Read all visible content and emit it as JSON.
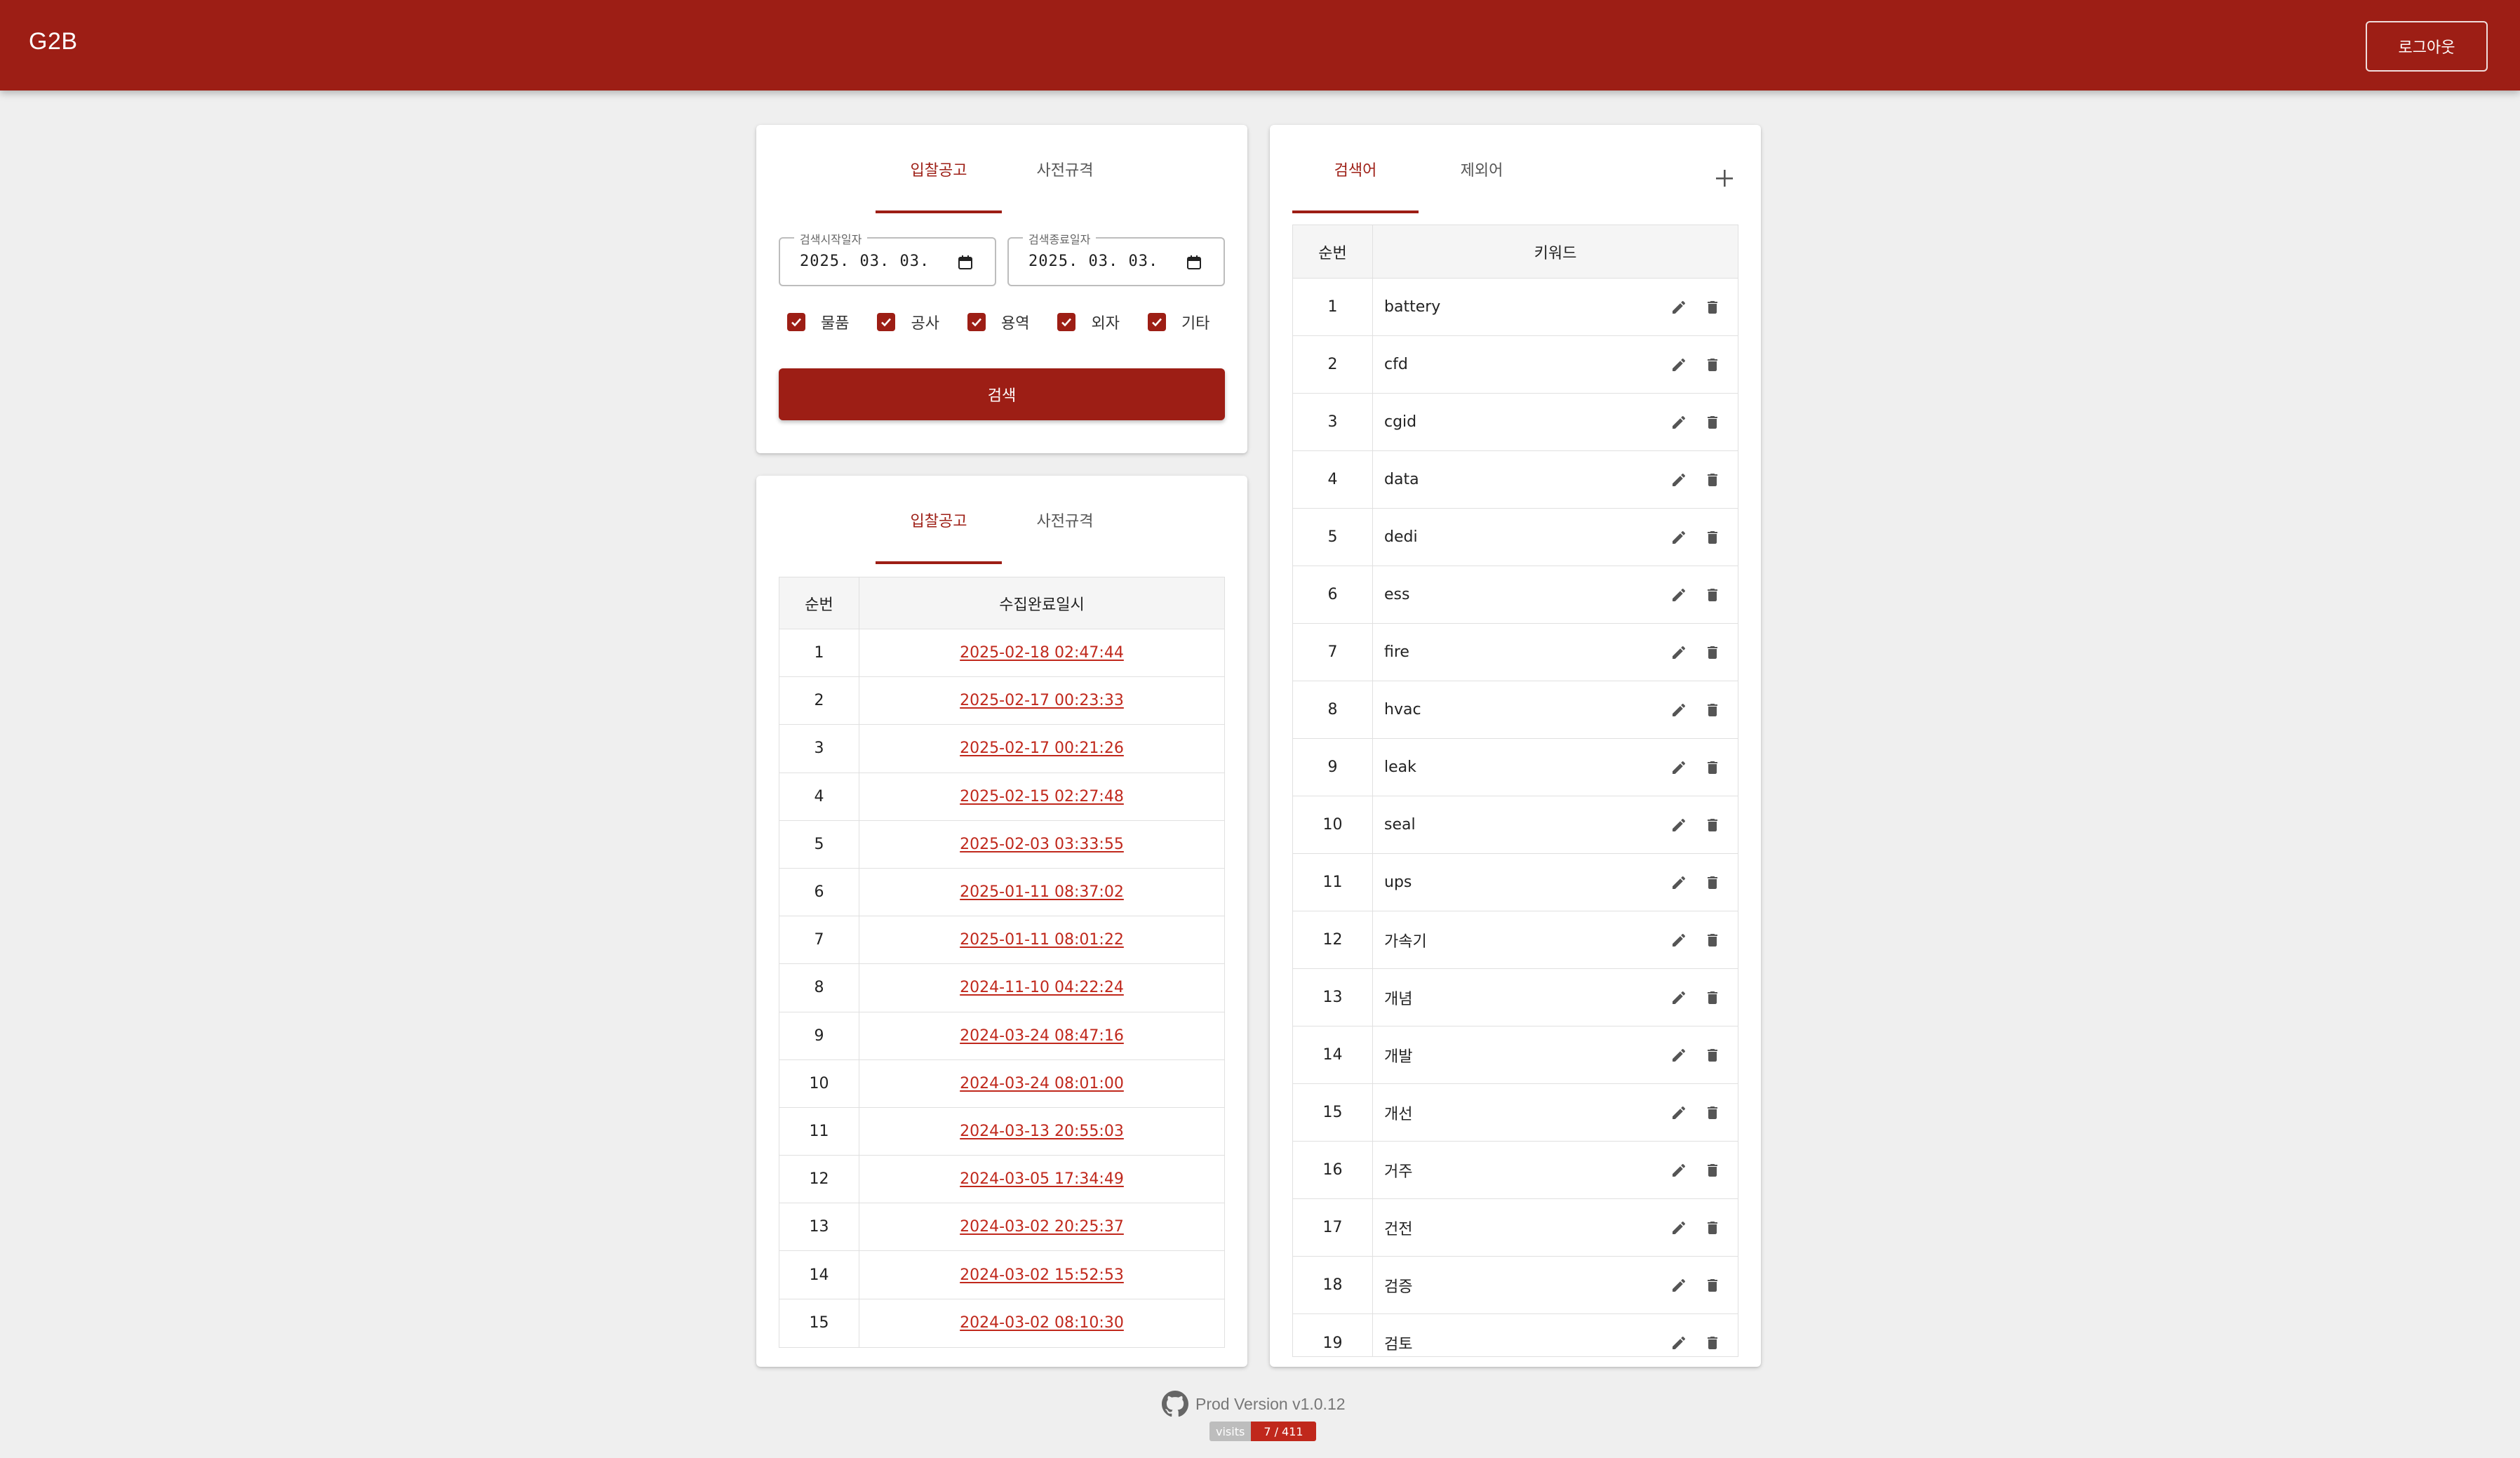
{
  "header": {
    "title": "G2B",
    "logout_label": "로그아웃"
  },
  "search_card": {
    "tabs": [
      {
        "label": "입찰공고",
        "active": true
      },
      {
        "label": "사전규격",
        "active": false
      }
    ],
    "start_date": {
      "label": "검색시작일자",
      "value": "2025. 03. 03."
    },
    "end_date": {
      "label": "검색종료일자",
      "value": "2025. 03. 03."
    },
    "categories": [
      {
        "label": "물품",
        "checked": true
      },
      {
        "label": "공사",
        "checked": true
      },
      {
        "label": "용역",
        "checked": true
      },
      {
        "label": "외자",
        "checked": true
      },
      {
        "label": "기타",
        "checked": true
      }
    ],
    "search_label": "검색"
  },
  "history_card": {
    "tabs": [
      {
        "label": "입찰공고",
        "active": true
      },
      {
        "label": "사전규격",
        "active": false
      }
    ],
    "columns": {
      "num": "순번",
      "date": "수집완료일시"
    },
    "rows": [
      {
        "num": "1",
        "date": "2025-02-18 02:47:44"
      },
      {
        "num": "2",
        "date": "2025-02-17 00:23:33"
      },
      {
        "num": "3",
        "date": "2025-02-17 00:21:26"
      },
      {
        "num": "4",
        "date": "2025-02-15 02:27:48"
      },
      {
        "num": "5",
        "date": "2025-02-03 03:33:55"
      },
      {
        "num": "6",
        "date": "2025-01-11 08:37:02"
      },
      {
        "num": "7",
        "date": "2025-01-11 08:01:22"
      },
      {
        "num": "8",
        "date": "2024-11-10 04:22:24"
      },
      {
        "num": "9",
        "date": "2024-03-24 08:47:16"
      },
      {
        "num": "10",
        "date": "2024-03-24 08:01:00"
      },
      {
        "num": "11",
        "date": "2024-03-13 20:55:03"
      },
      {
        "num": "12",
        "date": "2024-03-05 17:34:49"
      },
      {
        "num": "13",
        "date": "2024-03-02 20:25:37"
      },
      {
        "num": "14",
        "date": "2024-03-02 15:52:53"
      },
      {
        "num": "15",
        "date": "2024-03-02 08:10:30"
      }
    ]
  },
  "keyword_card": {
    "tabs": [
      {
        "label": "검색어",
        "active": true
      },
      {
        "label": "제외어",
        "active": false
      }
    ],
    "columns": {
      "num": "순번",
      "keyword": "키워드"
    },
    "rows": [
      {
        "num": "1",
        "keyword": "battery"
      },
      {
        "num": "2",
        "keyword": "cfd"
      },
      {
        "num": "3",
        "keyword": "cgid"
      },
      {
        "num": "4",
        "keyword": "data"
      },
      {
        "num": "5",
        "keyword": "dedi"
      },
      {
        "num": "6",
        "keyword": "ess"
      },
      {
        "num": "7",
        "keyword": "fire"
      },
      {
        "num": "8",
        "keyword": "hvac"
      },
      {
        "num": "9",
        "keyword": "leak"
      },
      {
        "num": "10",
        "keyword": "seal"
      },
      {
        "num": "11",
        "keyword": "ups"
      },
      {
        "num": "12",
        "keyword": "가속기"
      },
      {
        "num": "13",
        "keyword": "개념"
      },
      {
        "num": "14",
        "keyword": "개발"
      },
      {
        "num": "15",
        "keyword": "개선"
      },
      {
        "num": "16",
        "keyword": "거주"
      },
      {
        "num": "17",
        "keyword": "건전"
      },
      {
        "num": "18",
        "keyword": "검증"
      },
      {
        "num": "19",
        "keyword": "검토"
      }
    ]
  },
  "footer": {
    "version": "Prod Version v1.0.12",
    "badge_label": "visits",
    "badge_value": "7 / 411"
  },
  "colors": {
    "primary": "#9d1e15",
    "link": "#c0281c",
    "background": "#efefef"
  }
}
